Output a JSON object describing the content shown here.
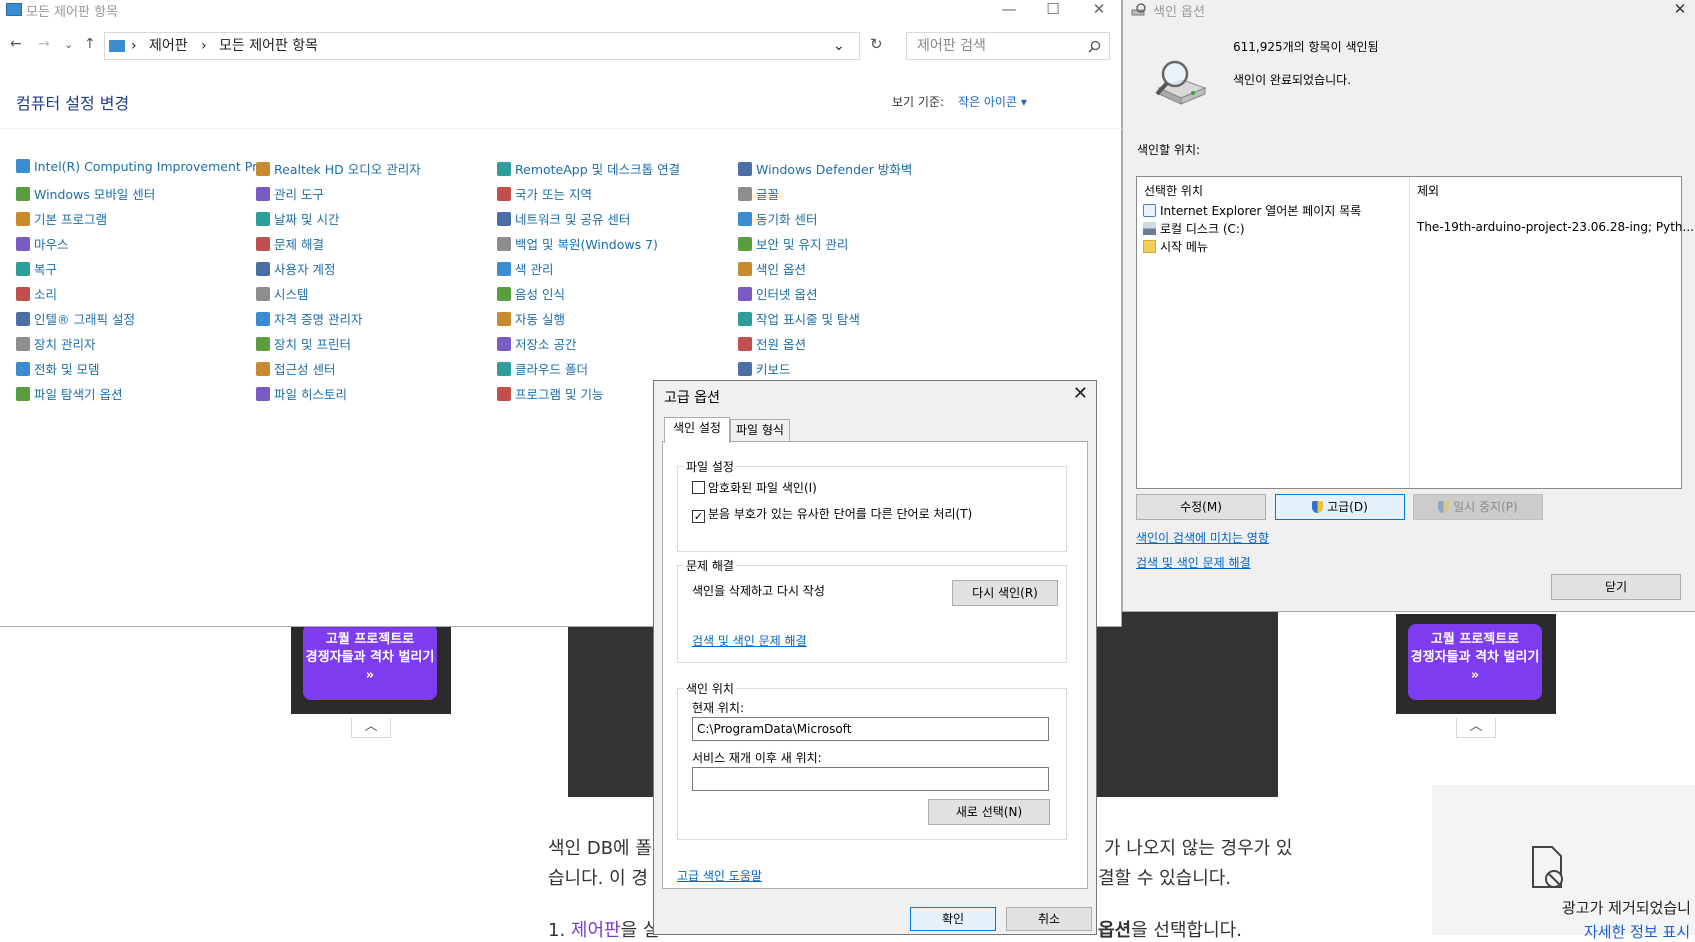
{
  "background_page": {
    "promo_text_1": "고퀄 프로젝트로",
    "promo_text_2": "경쟁자들과 격차 벌리기",
    "promo_arrow": "»",
    "chevron": "︿",
    "article_line_1a": "색인 DB에 폴",
    "article_line_1b": "가 나오지 않는 경우가 있",
    "article_line_2a": "습니다. 이 경",
    "article_line_2b": "결할 수 있습니다.",
    "article_line_3a": "1. ",
    "article_line_3link": "제어판",
    "article_line_3b": "을 실",
    "article_line_3c": "옵션",
    "article_line_3d": "을 선택합니다.",
    "ad_text": "광고가 제거되었습니",
    "ad_link": "자세한 정보 표시"
  },
  "control_panel": {
    "title": "모든 제어판 항목",
    "minimize": "—",
    "maximize": "☐",
    "close": "✕",
    "nav_back": "←",
    "nav_forward": "→",
    "nav_recent": "⌄",
    "nav_up": "↑",
    "breadcrumb_1": "제어판",
    "breadcrumb_2": "모든 제어판 항목",
    "breadcrumb_sep": "›",
    "dropdown_arrow": "⌄",
    "refresh": "↻",
    "search_placeholder": "제어판 검색",
    "heading": "컴퓨터 설정 변경",
    "view_by_label": "보기 기준:",
    "view_by_value": "작은 아이콘 ▾",
    "items": [
      "Intel(R) Computing Improvement Pr...",
      "Windows 모바일 센터",
      "기본 프로그램",
      "마우스",
      "복구",
      "소리",
      "인텔® 그래픽 설정",
      "장치 관리자",
      "전화 및 모뎀",
      "파일 탐색기 옵션",
      "Realtek HD 오디오 관리자",
      "관리 도구",
      "날짜 및 시간",
      "문제 해결",
      "사용자 계정",
      "시스템",
      "자격 증명 관리자",
      "장치 및 프린터",
      "접근성 센터",
      "파일 히스토리",
      "RemoteApp 및 데스크톱 연결",
      "국가 또는 지역",
      "네트워크 및 공유 센터",
      "백업 및 복원(Windows 7)",
      "색 관리",
      "음성 인식",
      "자동 실행",
      "저장소 공간",
      "클라우드 폴더",
      "프로그램 및 기능",
      "Windows Defender 방화벽",
      "글꼴",
      "동기화 센터",
      "보안 및 유지 관리",
      "색인 옵션",
      "인터넷 옵션",
      "작업 표시줄 및 탐색",
      "전원 옵션",
      "키보드"
    ]
  },
  "indexing_options": {
    "title": "색인 옵션",
    "close": "✕",
    "count_text": "611,925개의 항목이 색인됨",
    "status_text": "색인이 완료되었습니다.",
    "locations_label": "색인할 위치:",
    "col_included": "선택한 위치",
    "col_excluded": "제외",
    "rows": [
      "Internet Explorer 열어본 페이지 목록",
      "로컬 디스크 (C:)",
      "시작 메뉴"
    ],
    "excluded_text": "The-19th-arduino-project-23.06.28-ing; Pyth...",
    "modify_button": "수정(M)",
    "advanced_button": "고급(D)",
    "pause_button": "일시 중지(P)",
    "link_1": "색인이 검색에 미치는 영향",
    "link_2": "검색 및 색인 문제 해결",
    "close_button": "닫기"
  },
  "advanced_options": {
    "title": "고급 옵션",
    "close": "✕",
    "tab_index_settings": "색인 설정",
    "tab_file_types": "파일 형식",
    "file_settings_group": "파일 설정",
    "encrypted_label": "암호화된 파일 색인(I)",
    "encrypted_checked": false,
    "diacritics_label": "분음 부호가 있는 유사한 단어를 다른 단어로 처리(T)",
    "diacritics_checked": true,
    "check_mark": "✓",
    "troubleshoot_group": "문제 해결",
    "rebuild_text": "색인을 삭제하고 다시 작성",
    "rebuild_button": "다시 색인(R)",
    "troubleshoot_link": "검색 및 색인 문제 해결",
    "index_location_group": "색인 위치",
    "current_location_label": "현재 위치:",
    "current_location_value": "C:\\ProgramData\\Microsoft",
    "new_location_label": "서비스 재개 이후 새 위치:",
    "new_location_value": "",
    "select_new_button": "새로 선택(N)",
    "help_link": "고급 색인 도움말",
    "ok_button": "확인",
    "cancel_button": "취소"
  }
}
